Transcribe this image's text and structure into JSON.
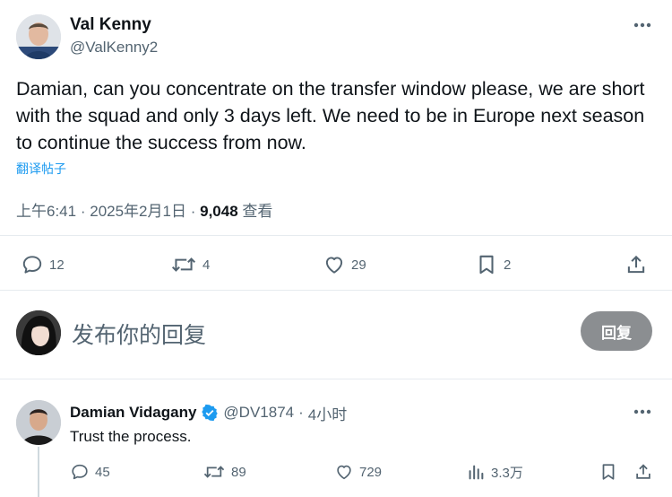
{
  "main_tweet": {
    "author_name": "Val Kenny",
    "author_handle": "@ValKenny2",
    "text": "Damian, can you concentrate on the transfer window please, we are short with the squad and only 3 days left. We need to be in Europe next season to continue the success from now.",
    "translate_label": "翻译帖子",
    "time": "上午6:41",
    "separator": "·",
    "date": "2025年2月1日",
    "views_count": "9,048",
    "views_label": "查看",
    "actions": {
      "replies": "12",
      "reposts": "4",
      "likes": "29",
      "bookmarks": "2"
    }
  },
  "composer": {
    "placeholder": "发布你的回复",
    "reply_button_label": "回复"
  },
  "reply_tweet": {
    "author_name": "Damian Vidagany",
    "author_handle": "@DV1874",
    "separator": "·",
    "time_ago": "4小时",
    "text": "Trust the process.",
    "actions": {
      "replies": "45",
      "reposts": "89",
      "likes": "729",
      "views": "3.3万"
    }
  },
  "colors": {
    "accent": "#1d9bf0",
    "secondary_text": "#536471",
    "primary_text": "#0f1419",
    "reply_button_bg": "#8b8e91",
    "verified_badge": "#1d9bf0"
  },
  "icons": {
    "more": "more-horizontal-icon",
    "reply": "comment-icon",
    "repost": "repost-icon",
    "like": "heart-icon",
    "bookmark": "bookmark-icon",
    "share": "share-icon",
    "views": "views-chart-icon",
    "verified": "verified-badge-icon"
  }
}
